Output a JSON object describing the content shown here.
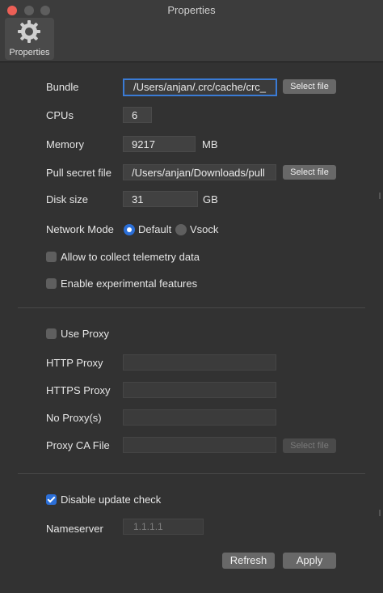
{
  "window": {
    "title": "Properties"
  },
  "toolbar": {
    "tab_label": "Properties",
    "tab_icon": "gear-icon"
  },
  "form": {
    "bundle": {
      "label": "Bundle",
      "value": "/Users/anjan/.crc/cache/crc_",
      "button": "Select file"
    },
    "cpus": {
      "label": "CPUs",
      "value": "6"
    },
    "memory": {
      "label": "Memory",
      "value": "9217",
      "unit": "MB"
    },
    "pull_secret": {
      "label": "Pull secret file",
      "value": "/Users/anjan/Downloads/pull",
      "button": "Select file"
    },
    "disk_size": {
      "label": "Disk size",
      "value": "31",
      "unit": "GB"
    },
    "network_mode": {
      "label": "Network Mode",
      "options": [
        "Default",
        "Vsock"
      ],
      "selected": "Default"
    },
    "telemetry": {
      "label": "Allow to collect telemetry data",
      "checked": false
    },
    "experimental": {
      "label": "Enable experimental features",
      "checked": false
    }
  },
  "proxy": {
    "use_proxy": {
      "label": "Use Proxy",
      "checked": false
    },
    "http": {
      "label": "HTTP Proxy",
      "value": ""
    },
    "https": {
      "label": "HTTPS Proxy",
      "value": ""
    },
    "no_proxy": {
      "label": "No Proxy(s)",
      "value": ""
    },
    "ca_file": {
      "label": "Proxy CA File",
      "value": "",
      "button": "Select file"
    }
  },
  "misc": {
    "disable_update": {
      "label": "Disable update check",
      "checked": true
    },
    "nameserver": {
      "label": "Nameserver",
      "placeholder": "1.1.1.1"
    }
  },
  "actions": {
    "refresh": "Refresh",
    "apply": "Apply"
  },
  "colors": {
    "accent": "#2b6fd8",
    "close": "#ec5f56"
  }
}
